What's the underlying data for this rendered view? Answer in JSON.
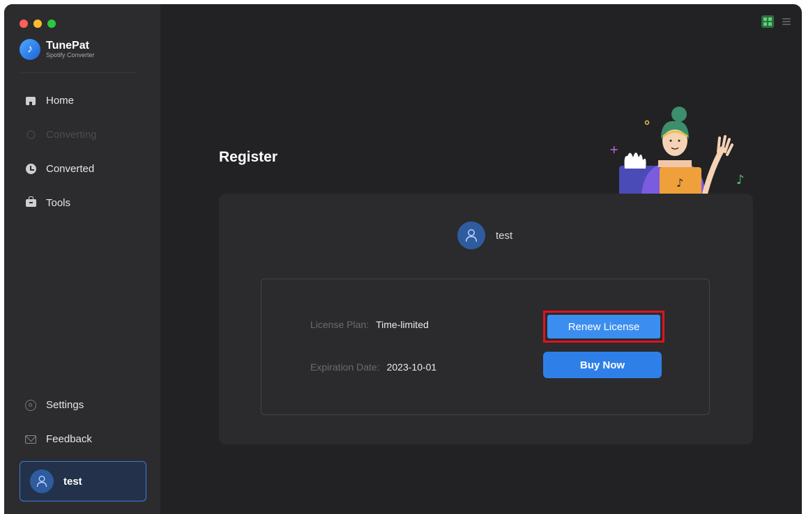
{
  "app": {
    "name": "TunePat",
    "subtitle": "Spotify Converter"
  },
  "sidebar": {
    "items": [
      {
        "label": "Home",
        "icon": "home-icon"
      },
      {
        "label": "Converting",
        "icon": "converting-icon"
      },
      {
        "label": "Converted",
        "icon": "clock-icon"
      },
      {
        "label": "Tools",
        "icon": "toolbox-icon"
      }
    ],
    "bottom_items": [
      {
        "label": "Settings",
        "icon": "gear-icon"
      },
      {
        "label": "Feedback",
        "icon": "mail-icon"
      }
    ],
    "user": {
      "name": "test"
    }
  },
  "main": {
    "title": "Register",
    "user_name": "test",
    "license": {
      "plan_label": "License Plan:",
      "plan_value": "Time-limited",
      "expiry_label": "Expiration Date:",
      "expiry_value": "2023-10-01"
    },
    "buttons": {
      "renew": "Renew License",
      "buy": "Buy Now"
    }
  },
  "colors": {
    "accent": "#2f7fe8",
    "highlight_box": "#e0121f",
    "background": "#222224",
    "sidebar": "#2c2c2e"
  }
}
